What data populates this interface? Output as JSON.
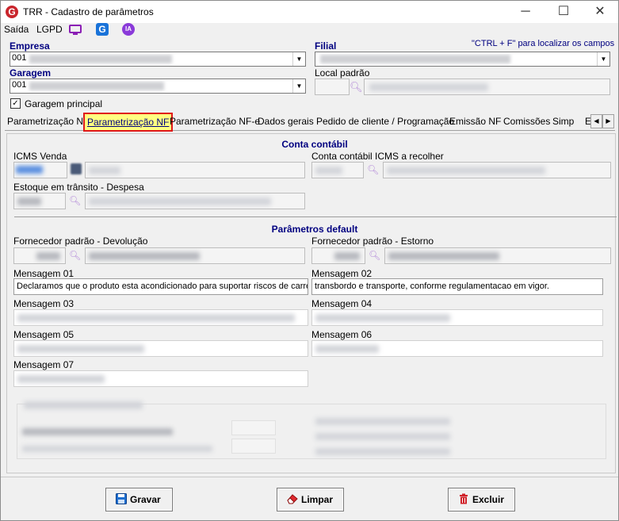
{
  "window": {
    "title": "TRR - Cadastro de parâmetros",
    "minimize": "─",
    "maximize": "☐",
    "close": "✕"
  },
  "menu": {
    "saida": "Saída",
    "lgpd": "LGPD",
    "ia": "IA",
    "g": "G"
  },
  "header": {
    "empresa_label": "Empresa",
    "empresa_code": "001",
    "filial_label": "Filial",
    "hint": "\"CTRL + F\" para localizar os campos",
    "garagem_label": "Garagem",
    "garagem_code": "001",
    "local_padrao_label": "Local padrão",
    "garagem_principal_label": "Garagem principal",
    "garagem_principal_checked": true
  },
  "tabs": [
    "Parametrização NF",
    "Parametrização NF",
    "Parametrização NF-e",
    "Dados gerais",
    "Pedido de cliente / Programação",
    "Emissão NF",
    "Comissões",
    "Simp",
    "E"
  ],
  "selected_tab_index": 1,
  "conta_contabil": {
    "title": "Conta contábil",
    "icms_venda": "ICMS Venda",
    "icms_recolher": "Conta contábil ICMS a recolher",
    "estoque_transito": "Estoque em trânsito - Despesa"
  },
  "parametros": {
    "title": "Parâmetros default",
    "fornecedor_devolucao": "Fornecedor padrão - Devolução",
    "fornecedor_estorno": "Fornecedor padrão - Estorno",
    "mensagem01_label": "Mensagem 01",
    "mensagem01_value": "Declaramos que o produto esta acondicionado para suportar riscos de carrega",
    "mensagem02_label": "Mensagem 02",
    "mensagem02_value": "transbordo e transporte, conforme regulamentacao em vigor.",
    "mensagem03_label": "Mensagem 03",
    "mensagem04_label": "Mensagem 04",
    "mensagem05_label": "Mensagem 05",
    "mensagem06_label": "Mensagem 06",
    "mensagem07_label": "Mensagem 07"
  },
  "buttons": {
    "gravar": "Gravar",
    "limpar": "Limpar",
    "excluir": "Excluir"
  },
  "colors": {
    "accent": "#000080",
    "tab_highlight": "#ffff80",
    "tab_border": "#e01818",
    "brand_red": "#c9252c"
  }
}
